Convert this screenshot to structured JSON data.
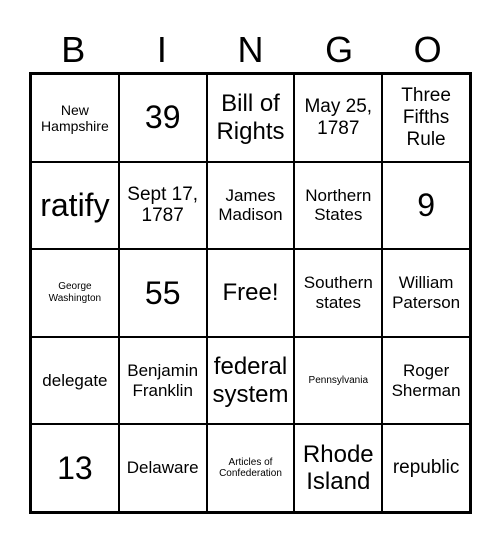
{
  "header": [
    "B",
    "I",
    "N",
    "G",
    "O"
  ],
  "cells": [
    {
      "text": "New Hampshire",
      "size": "s-sm"
    },
    {
      "text": "39",
      "size": "s-xxl"
    },
    {
      "text": "Bill of Rights",
      "size": "s-xl"
    },
    {
      "text": "May 25, 1787",
      "size": "s-lg"
    },
    {
      "text": "Three Fifths Rule",
      "size": "s-lg"
    },
    {
      "text": "ratify",
      "size": "s-xxl"
    },
    {
      "text": "Sept 17, 1787",
      "size": "s-lg"
    },
    {
      "text": "James Madison",
      "size": "s-md"
    },
    {
      "text": "Northern States",
      "size": "s-md"
    },
    {
      "text": "9",
      "size": "s-xxl"
    },
    {
      "text": "George Washington",
      "size": "s-xs"
    },
    {
      "text": "55",
      "size": "s-xxl"
    },
    {
      "text": "Free!",
      "size": "s-xl"
    },
    {
      "text": "Southern states",
      "size": "s-md"
    },
    {
      "text": "William Paterson",
      "size": "s-md"
    },
    {
      "text": "delegate",
      "size": "s-md"
    },
    {
      "text": "Benjamin Franklin",
      "size": "s-md"
    },
    {
      "text": "federal system",
      "size": "s-xl"
    },
    {
      "text": "Pennsylvania",
      "size": "s-xs"
    },
    {
      "text": "Roger Sherman",
      "size": "s-md"
    },
    {
      "text": "13",
      "size": "s-xxl"
    },
    {
      "text": "Delaware",
      "size": "s-md"
    },
    {
      "text": "Articles of Confederation",
      "size": "s-xs"
    },
    {
      "text": "Rhode Island",
      "size": "s-xl"
    },
    {
      "text": "republic",
      "size": "s-lg"
    }
  ]
}
